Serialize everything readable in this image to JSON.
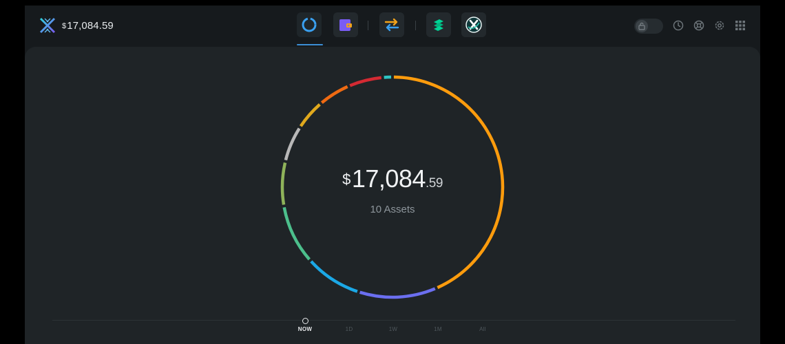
{
  "header": {
    "currency_symbol": "$",
    "balance": "17,084.59",
    "nav_tabs": [
      {
        "id": "portfolio",
        "icon": "portfolio-donut-icon",
        "active": true
      },
      {
        "id": "wallet",
        "icon": "wallet-icon",
        "active": false
      },
      {
        "id": "exchange",
        "icon": "exchange-arrows-icon",
        "active": false
      },
      {
        "id": "compound",
        "icon": "compound-icon",
        "active": false
      },
      {
        "id": "xclusive",
        "icon": "x-coin-icon",
        "active": false
      }
    ],
    "right_icons": [
      "lock-icon",
      "history-icon",
      "support-icon",
      "settings-icon",
      "grid-icon"
    ]
  },
  "portfolio": {
    "currency_symbol": "$",
    "balance_whole": "17,084",
    "balance_cents": ".59",
    "asset_count": "10 Assets"
  },
  "allocation": [
    {
      "color": "#ff9c0d",
      "share": 0.428
    },
    {
      "color": "#6b6ff0",
      "share": 0.113
    },
    {
      "color": "#1ba8e6",
      "share": 0.083
    },
    {
      "color": "#4cbf8c",
      "share": 0.087
    },
    {
      "color": "#8fb35a",
      "share": 0.064
    },
    {
      "color": "#b8b8b8",
      "share": 0.053
    },
    {
      "color": "#e0a91d",
      "share": 0.045
    },
    {
      "color": "#ef6a12",
      "share": 0.047
    },
    {
      "color": "#d42a33",
      "share": 0.05
    },
    {
      "color": "#2ec4c4",
      "share": 0.014
    }
  ],
  "timeline": {
    "items": [
      "NOW",
      "1D",
      "1W",
      "1M",
      "All"
    ],
    "active": "NOW"
  },
  "colors": {
    "accent": "#3c8fd6",
    "background": "#161a1d",
    "panel": "#1f2427"
  }
}
